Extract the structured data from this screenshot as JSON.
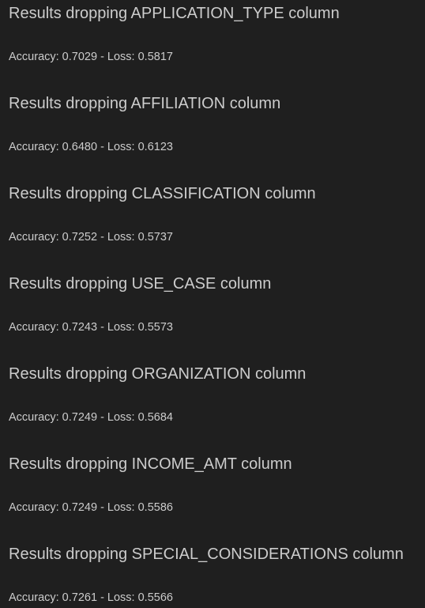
{
  "results": [
    {
      "heading": "Results dropping APPLICATION_TYPE column",
      "metrics": "Accuracy: 0.7029 - Loss: 0.5817"
    },
    {
      "heading": "Results dropping AFFILIATION column",
      "metrics": "Accuracy: 0.6480 - Loss: 0.6123"
    },
    {
      "heading": "Results dropping CLASSIFICATION column",
      "metrics": "Accuracy: 0.7252 - Loss: 0.5737"
    },
    {
      "heading": "Results dropping USE_CASE column",
      "metrics": "Accuracy: 0.7243 - Loss: 0.5573"
    },
    {
      "heading": "Results dropping ORGANIZATION column",
      "metrics": "Accuracy: 0.7249 - Loss: 0.5684"
    },
    {
      "heading": "Results dropping INCOME_AMT column",
      "metrics": "Accuracy: 0.7249 - Loss: 0.5586"
    },
    {
      "heading": "Results dropping SPECIAL_CONSIDERATIONS column",
      "metrics": "Accuracy: 0.7261 - Loss: 0.5566"
    }
  ]
}
